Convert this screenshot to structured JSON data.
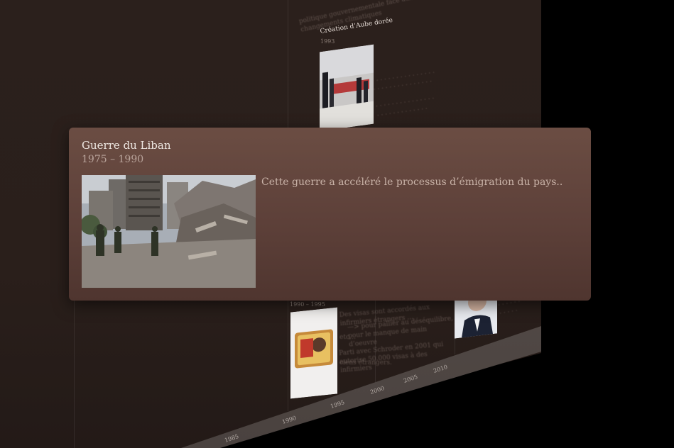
{
  "popup": {
    "title": "Guerre du Liban",
    "years": "1975 – 1990",
    "description": "Cette guerre a accéléré le processus d’émigration du pays..",
    "photo_icon": "war-ruins-photo"
  },
  "background_events": [
    {
      "title": "Création d’Aube dorée",
      "year": "1993"
    },
    {
      "title": "",
      "year": "1990 – 1995"
    }
  ],
  "background_text": {
    "top_line_1": "politique gouvernementale face aux changements climatiques",
    "dates_block": "Des visas sont accordés aux infirmiers étrangers …",
    "arrow_line": "—> pour pallier au déséquilibre, pour le manque de main d’oeuvre",
    "etc": "etc…",
    "schroder": "Parti avec Schroder en 2001 qui autorise 50.000 visas à des infirmiers",
    "ciens": "ciens étrangers."
  },
  "axis_ticks": [
    "1985",
    "1990",
    "1995",
    "2000",
    "2005",
    "2010"
  ],
  "colors": {
    "card_top": "#6b4d43",
    "card_bottom": "#4f352f",
    "wall": "#2b201c",
    "text_light": "#eee7e2",
    "text_muted": "#b9a49b"
  }
}
